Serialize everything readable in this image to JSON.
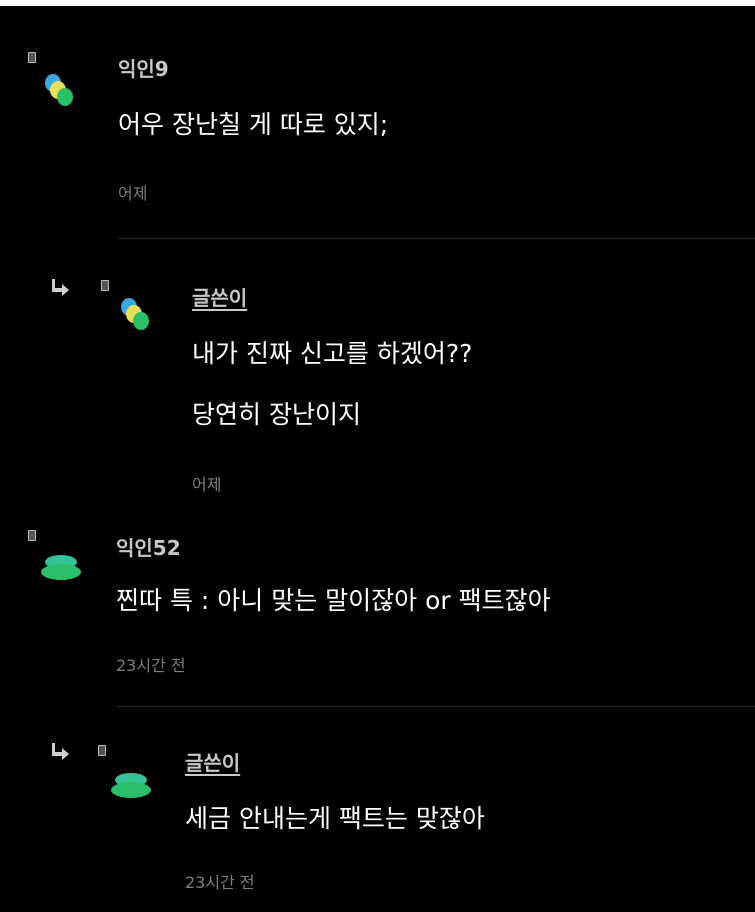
{
  "comments": [
    {
      "nickname": "익인9",
      "lines": [
        "어우 장난칠 게 따로 있지;"
      ],
      "time": "어제",
      "is_reply": false,
      "avatar": "blob-avatar"
    },
    {
      "nickname": "글쓴이",
      "lines": [
        "내가 진짜 신고를 하겠어??",
        "당연히 장난이지"
      ],
      "time": "어제",
      "is_reply": true,
      "avatar": "blob-avatar"
    },
    {
      "nickname": "익인52",
      "lines": [
        "찐따 특 : 아니 맞는 말이잖아 or 팩트잖아"
      ],
      "time": "23시간 전",
      "is_reply": false,
      "avatar": "disc-avatar"
    },
    {
      "nickname": "글쓴이",
      "lines": [
        "세금 안내는게 팩트는 맞잖아"
      ],
      "time": "23시간 전",
      "is_reply": true,
      "avatar": "disc-avatar"
    }
  ],
  "colors": {
    "background": "#000000",
    "avatar_blue": "#3aa9e0",
    "avatar_yellow": "#e6e05a",
    "avatar_green": "#2bbf6a",
    "avatar_teal": "#35c49a"
  }
}
